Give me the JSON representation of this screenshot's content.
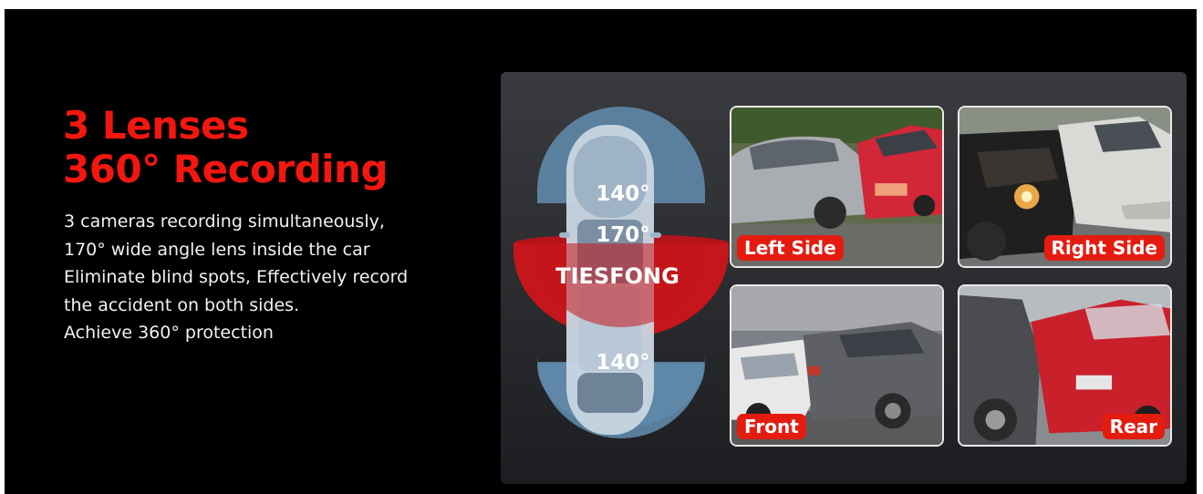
{
  "headline": {
    "line1": "3 Lenses",
    "line2": "360° Recording"
  },
  "description": [
    "3 cameras recording simultaneously,",
    "170° wide angle lens inside the car",
    "Eliminate blind spots, Effectively record",
    "the accident on both sides.",
    "Achieve 360° protection"
  ],
  "diagram": {
    "front_angle": "140°",
    "inside_angle": "170°",
    "rear_angle": "140°",
    "brand": "TIESFONG"
  },
  "views": [
    {
      "label": "Left Side"
    },
    {
      "label": "Right Side"
    },
    {
      "label": "Front"
    },
    {
      "label": "Rear"
    }
  ],
  "colors": {
    "accent_red": "#f3170f",
    "label_red": "#e41c10",
    "lens_blue": "#5f88aa",
    "background": "#000000"
  }
}
